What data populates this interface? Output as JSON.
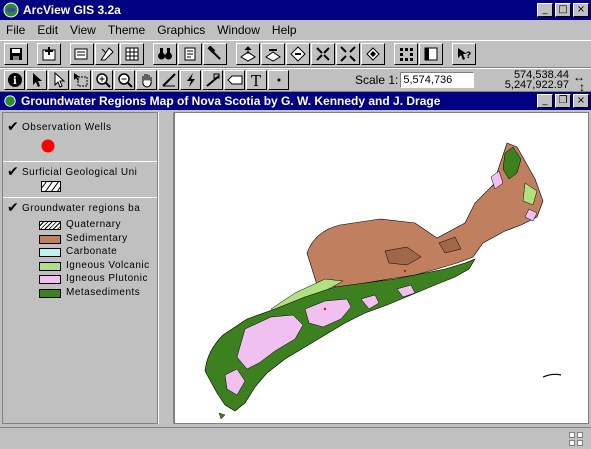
{
  "app": {
    "title": "ArcView GIS 3.2a"
  },
  "menu": [
    "File",
    "Edit",
    "View",
    "Theme",
    "Graphics",
    "Window",
    "Help"
  ],
  "toolbar": {
    "scale_label": "Scale 1:",
    "scale_value": "5,574,736",
    "coord_x": "574,538.44",
    "coord_y": "5,247,922.97"
  },
  "document": {
    "title": "Groundwater Regions Map of Nova Scotia by G. W. Kennedy and J. Drage"
  },
  "themes": [
    {
      "name": "Observation Wells",
      "checked": true
    },
    {
      "name": "Surficial Geological Uni",
      "checked": true
    },
    {
      "name": "Groundwater regions ba",
      "checked": true
    }
  ],
  "legend": [
    {
      "label": "Quaternary",
      "color": "#ffffff",
      "hatch": true
    },
    {
      "label": "Sedimentary",
      "color": "#c08060"
    },
    {
      "label": "Carbonate",
      "color": "#c0f0f0"
    },
    {
      "label": "Igneous Volcanic",
      "color": "#b0e080"
    },
    {
      "label": "Igneous Plutonic",
      "color": "#f0c0f0"
    },
    {
      "label": "Metasediments",
      "color": "#3c8020"
    }
  ],
  "colors": {
    "titlebar": "#000080",
    "well_point": "#ff0000"
  }
}
